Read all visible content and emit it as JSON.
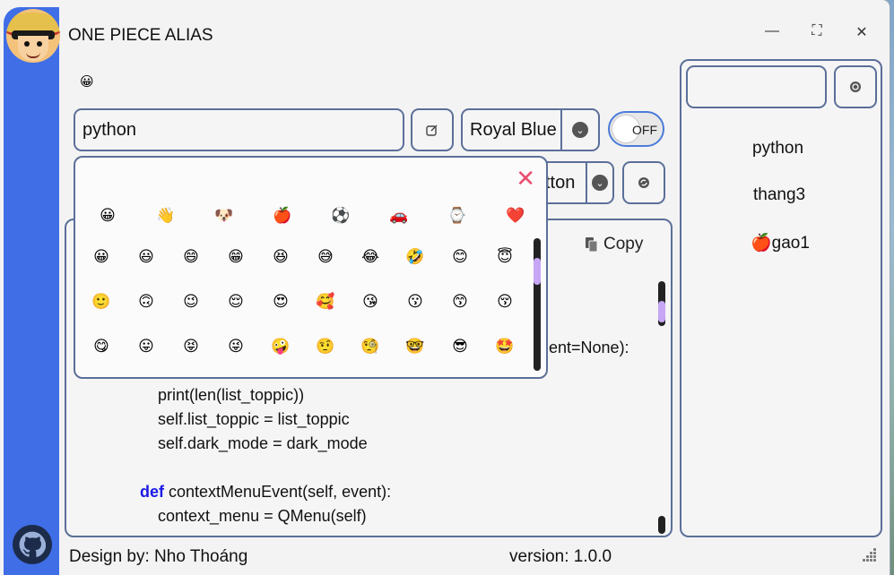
{
  "app": {
    "title": "ONE PIECE ALIAS"
  },
  "controls": {
    "minimize": "—",
    "maximize": "⛶",
    "close": "✕"
  },
  "toolbar": {
    "emoji_indicator": "😀",
    "alias_input_value": "python",
    "color_select_value": "Royal Blue",
    "toggle_label": "OFF",
    "button_combo_partial": "tton"
  },
  "editor": {
    "copy_label": "Copy",
    "partial_line": "ent=None):",
    "code_lines": [
      "        print(len(list_toppic))",
      "        self.list_toppic = list_toppic",
      "        self.dark_mode = dark_mode",
      "",
      "    def contextMenuEvent(self, event):",
      "        context_menu = QMenu(self)"
    ],
    "keyword": "def"
  },
  "emoji_picker": {
    "close_label": "✕",
    "categories": [
      "😀",
      "👋",
      "🐶",
      "🍎",
      "⚽",
      "🚗",
      "⌚",
      "❤️"
    ],
    "rows": [
      [
        "😀",
        "😃",
        "😄",
        "😁",
        "😆",
        "😅",
        "😂",
        "🤣",
        "😊",
        "😇"
      ],
      [
        "🙂",
        "🙃",
        "😉",
        "😌",
        "😍",
        "🥰",
        "😘",
        "😗",
        "😙",
        "😚"
      ],
      [
        "😋",
        "😛",
        "😝",
        "😜",
        "🤪",
        "🤨",
        "🧐",
        "🤓",
        "😎",
        "🤩"
      ]
    ]
  },
  "right_panel": {
    "search_value": "",
    "items": [
      {
        "icon": "",
        "label": "python"
      },
      {
        "icon": "",
        "label": "thang3"
      },
      {
        "icon": "🍎",
        "label": "gao1"
      }
    ]
  },
  "footer": {
    "credit": "Design by: Nho Thoáng",
    "version": "version: 1.0.0"
  },
  "colors": {
    "accent": "#3f6ee6",
    "border": "#5b6f99",
    "scroll_thumb": "#c7a6f5",
    "close_x": "#ea4c6c",
    "keyword": "#1a1ae6"
  }
}
